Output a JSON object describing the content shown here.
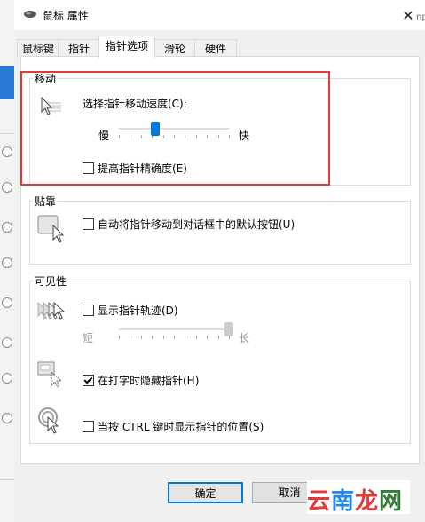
{
  "window": {
    "title": "鼠标 属性",
    "close_glyph": "✕"
  },
  "background": {
    "right_text": "np"
  },
  "tabs": [
    {
      "label": "鼠标键"
    },
    {
      "label": "指针"
    },
    {
      "label": "指针选项"
    },
    {
      "label": "滑轮"
    },
    {
      "label": "硬件"
    }
  ],
  "motion": {
    "title": "移动",
    "speed_label": "选择指针移动速度(C):",
    "slow_label": "慢",
    "fast_label": "快",
    "speed_value_fraction": 0.33,
    "precision_label": "提高指针精确度(E)",
    "precision_checked": false
  },
  "snap": {
    "title": "贴靠",
    "snap_label": "自动将指针移动到对话框中的默认按钮(U)",
    "snap_checked": false
  },
  "visibility": {
    "title": "可见性",
    "trails_label": "显示指针轨迹(D)",
    "trails_checked": false,
    "short_label": "短",
    "long_label": "长",
    "trails_value_fraction": 1.0,
    "hide_label": "在打字时隐藏指针(H)",
    "hide_checked": true,
    "ctrl_label": "当按 CTRL 键时显示指针的位置(S)",
    "ctrl_checked": false
  },
  "buttons": {
    "ok": "确定",
    "cancel": "取消"
  },
  "watermark": {
    "chars": [
      "云",
      "南",
      "龙",
      "网"
    ]
  },
  "colors": {
    "accent": "#0078d7",
    "highlight": "#e53935",
    "thumb_active": "#0078d7",
    "thumb_disabled": "#cccccc",
    "disabled_text": "#9a9a9a",
    "watermark_1": "#e53935",
    "watermark_2": "#1e88e5",
    "watermark_3": "#e53935",
    "watermark_4": "#2e7d32"
  }
}
